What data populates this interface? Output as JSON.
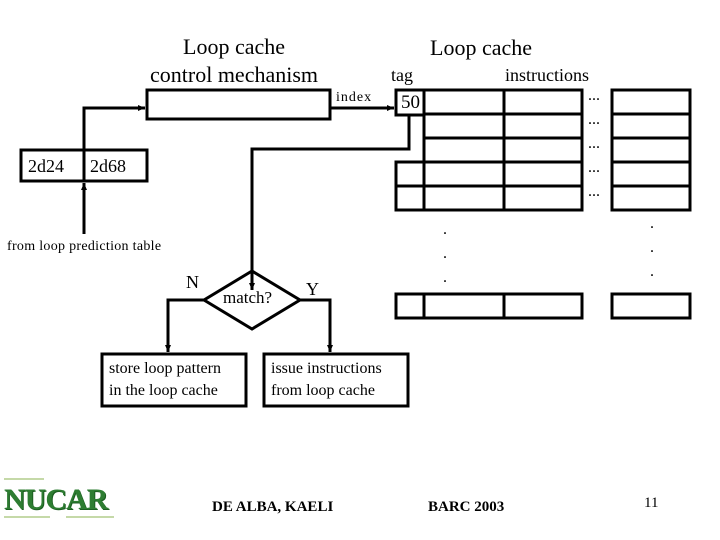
{
  "titles": {
    "control": [
      "Loop cache",
      "control mechanism"
    ],
    "cache": "Loop cache"
  },
  "labels": {
    "tag": "tag",
    "instructions": "instructions",
    "index": "index",
    "tag_value": "50",
    "ellipsis": "...",
    "vdots": ".",
    "branch_addr": "2d24",
    "target_addr": "2d68",
    "source": "from loop prediction table",
    "no": "N",
    "yes": "Y",
    "decision": "match?",
    "store": [
      "store loop pattern",
      "in the loop cache"
    ],
    "issue": [
      "issue instructions",
      "from loop cache"
    ]
  },
  "footer": {
    "logo": "NUCAR",
    "authors": "DE ALBA, KAELI",
    "venue": "BARC 2003",
    "page": "11"
  },
  "colors": {
    "stroke": "#000000",
    "logo": "#2e7d32"
  }
}
